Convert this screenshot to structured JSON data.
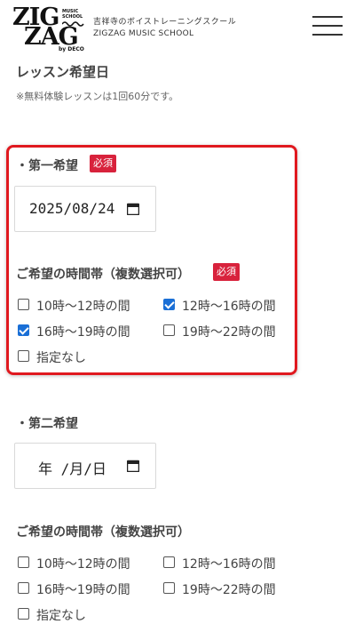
{
  "header": {
    "logo_zig": "ZIG",
    "logo_zag": "ZAG",
    "logo_music_school": "MUSIC SCHOOL",
    "logo_by_deco": "by DECO",
    "tagline_jp": "吉祥寺のボイストレーニングスクール",
    "tagline_en": "ZIGZAG MUSIC SCHOOL",
    "menu_icon": "hamburger-menu-icon"
  },
  "lesson": {
    "title": "レッスン希望日",
    "note": "※無料体験レッスンは1回60分です。"
  },
  "first_choice": {
    "label": "・第一希望",
    "required": "必須",
    "date_value": "2025/08/24",
    "time_label": "ご希望の時間帯（複数選択可）",
    "time_required": "必須",
    "options": [
      {
        "label": "10時〜12時の間",
        "checked": false
      },
      {
        "label": "12時〜16時の間",
        "checked": true
      },
      {
        "label": "16時〜19時の間",
        "checked": true
      },
      {
        "label": "19時〜22時の間",
        "checked": false
      },
      {
        "label": "指定なし",
        "checked": false
      }
    ]
  },
  "second_choice": {
    "label": "・第二希望",
    "date_placeholder": "年 /月/日",
    "time_label": "ご希望の時間帯（複数選択可）",
    "options": [
      {
        "label": "10時〜12時の間",
        "checked": false
      },
      {
        "label": "12時〜16時の間",
        "checked": false
      },
      {
        "label": "16時〜19時の間",
        "checked": false
      },
      {
        "label": "19時〜22時の間",
        "checked": false
      },
      {
        "label": "指定なし",
        "checked": false
      }
    ]
  },
  "colors": {
    "required_badge": "#d8223c",
    "highlight_border": "#e0191f",
    "checkbox_checked": "#1a6fd6"
  }
}
